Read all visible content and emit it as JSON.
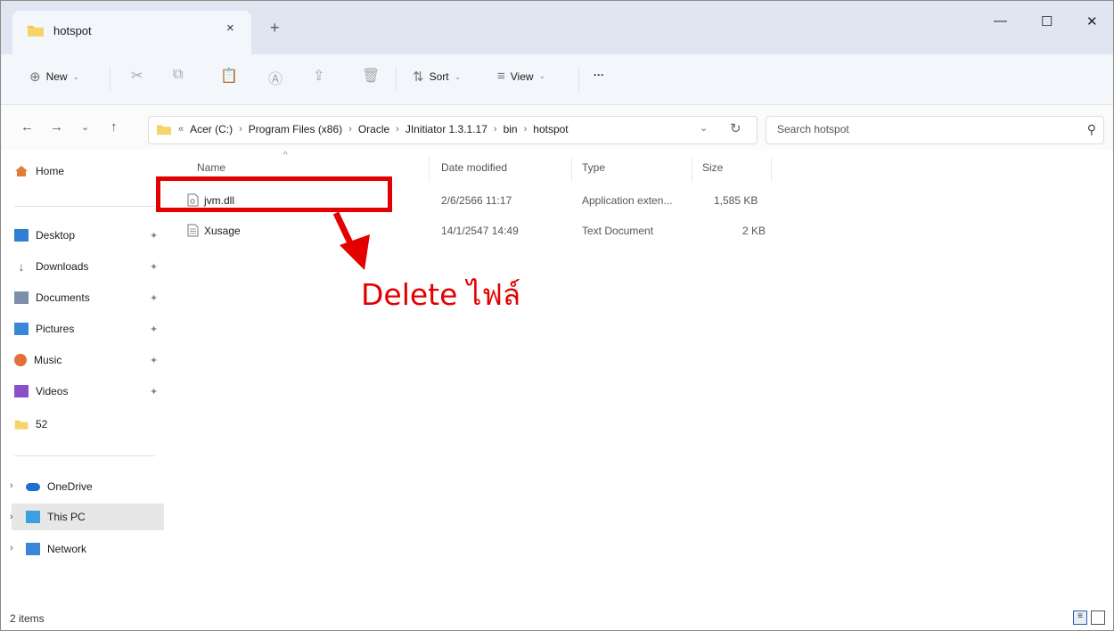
{
  "window": {
    "tab_title": "hotspot",
    "tab_close": "×",
    "new_tab": "+",
    "minimize": "—",
    "maximize": "☐",
    "close": "✕"
  },
  "toolbar": {
    "new_label": "New",
    "sort_label": "Sort",
    "view_label": "View",
    "more_label": "···"
  },
  "address": {
    "overflow": "«",
    "crumbs": [
      "Acer (C:)",
      "Program Files (x86)",
      "Oracle",
      "JInitiator 1.3.1.17",
      "bin",
      "hotspot"
    ]
  },
  "search": {
    "placeholder": "Search hotspot"
  },
  "sidebar": {
    "home": "Home",
    "quick": [
      "Desktop",
      "Downloads",
      "Documents",
      "Pictures",
      "Music",
      "Videos",
      "52"
    ],
    "drives": [
      "OneDrive",
      "This PC",
      "Network"
    ]
  },
  "columns": {
    "name": "Name",
    "date": "Date modified",
    "type": "Type",
    "size": "Size"
  },
  "files": [
    {
      "name": "jvm.dll",
      "date": "2/6/2566 11:17",
      "type": "Application exten...",
      "size": "1,585 KB"
    },
    {
      "name": "Xusage",
      "date": "14/1/2547 14:49",
      "type": "Text Document",
      "size": "2 KB"
    }
  ],
  "annotation": {
    "text": "Delete ไฟล์",
    "color": "#e30000"
  },
  "status": {
    "items": "2 items"
  },
  "colors": {
    "titlebar": "#dfe6f1",
    "accent": "#2a5ca8",
    "folder": "#f2c84b"
  }
}
